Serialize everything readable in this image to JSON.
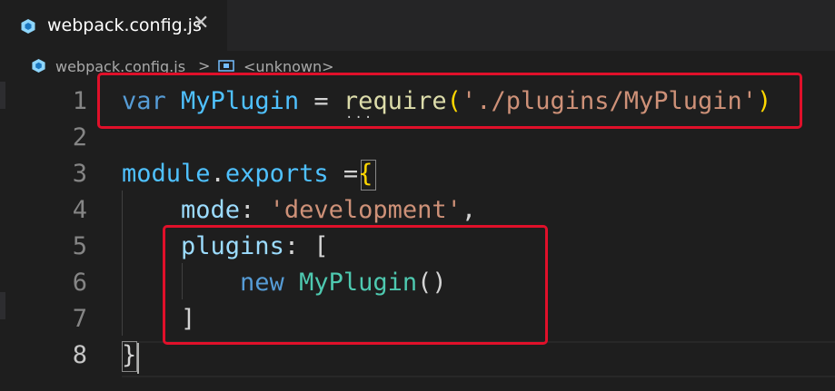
{
  "tab": {
    "filename": "webpack.config.js",
    "close_glyph": "✕",
    "icon": "webpack-cube-icon"
  },
  "breadcrumb": {
    "file": "webpack.config.js",
    "separator": ">",
    "symbol": "<unknown>",
    "file_icon": "webpack-cube-icon",
    "symbol_icon": "symbol-variable-icon"
  },
  "editor": {
    "active_line": 8,
    "lines": [
      {
        "number": "1",
        "tokens": [
          {
            "t": "var",
            "c": "kw"
          },
          {
            "t": " ",
            "c": "ws"
          },
          {
            "t": "MyPlugin",
            "c": "var"
          },
          {
            "t": " = ",
            "c": "pun"
          },
          {
            "t": "require",
            "c": "fn"
          },
          {
            "t": "(",
            "c": "brk"
          },
          {
            "t": "'./plugins/MyPlugin'",
            "c": "str"
          },
          {
            "t": ")",
            "c": "brk"
          }
        ]
      },
      {
        "number": "2",
        "tokens": []
      },
      {
        "number": "3",
        "tokens": [
          {
            "t": "module",
            "c": "var"
          },
          {
            "t": ".",
            "c": "pun"
          },
          {
            "t": "exports",
            "c": "var"
          },
          {
            "t": " =",
            "c": "pun"
          },
          {
            "t": "{",
            "c": "brk"
          }
        ]
      },
      {
        "number": "4",
        "tokens": [
          {
            "t": "    ",
            "c": "ws"
          },
          {
            "t": "mode",
            "c": "prop"
          },
          {
            "t": ": ",
            "c": "pun"
          },
          {
            "t": "'development'",
            "c": "str"
          },
          {
            "t": ",",
            "c": "pun"
          }
        ]
      },
      {
        "number": "5",
        "tokens": [
          {
            "t": "    ",
            "c": "ws"
          },
          {
            "t": "plugins",
            "c": "prop"
          },
          {
            "t": ": ",
            "c": "pun"
          },
          {
            "t": "[",
            "c": "pun"
          }
        ]
      },
      {
        "number": "6",
        "tokens": [
          {
            "t": "        ",
            "c": "ws"
          },
          {
            "t": "new",
            "c": "kw"
          },
          {
            "t": " ",
            "c": "ws"
          },
          {
            "t": "MyPlugin",
            "c": "cls"
          },
          {
            "t": "()",
            "c": "pun"
          }
        ]
      },
      {
        "number": "7",
        "tokens": [
          {
            "t": "    ",
            "c": "ws"
          },
          {
            "t": "]",
            "c": "pun"
          }
        ]
      },
      {
        "number": "8",
        "tokens": [
          {
            "t": "}",
            "c": "pun"
          }
        ]
      }
    ],
    "ellipsis": "..."
  },
  "colors": {
    "highlight_box": "#e0102a",
    "keyword": "#569cd6",
    "variable": "#4fc1ff",
    "function": "#dcdcaa",
    "string": "#ce9178",
    "property": "#9cdcfe",
    "class": "#4ec9b0",
    "bracket": "#ffd700"
  }
}
